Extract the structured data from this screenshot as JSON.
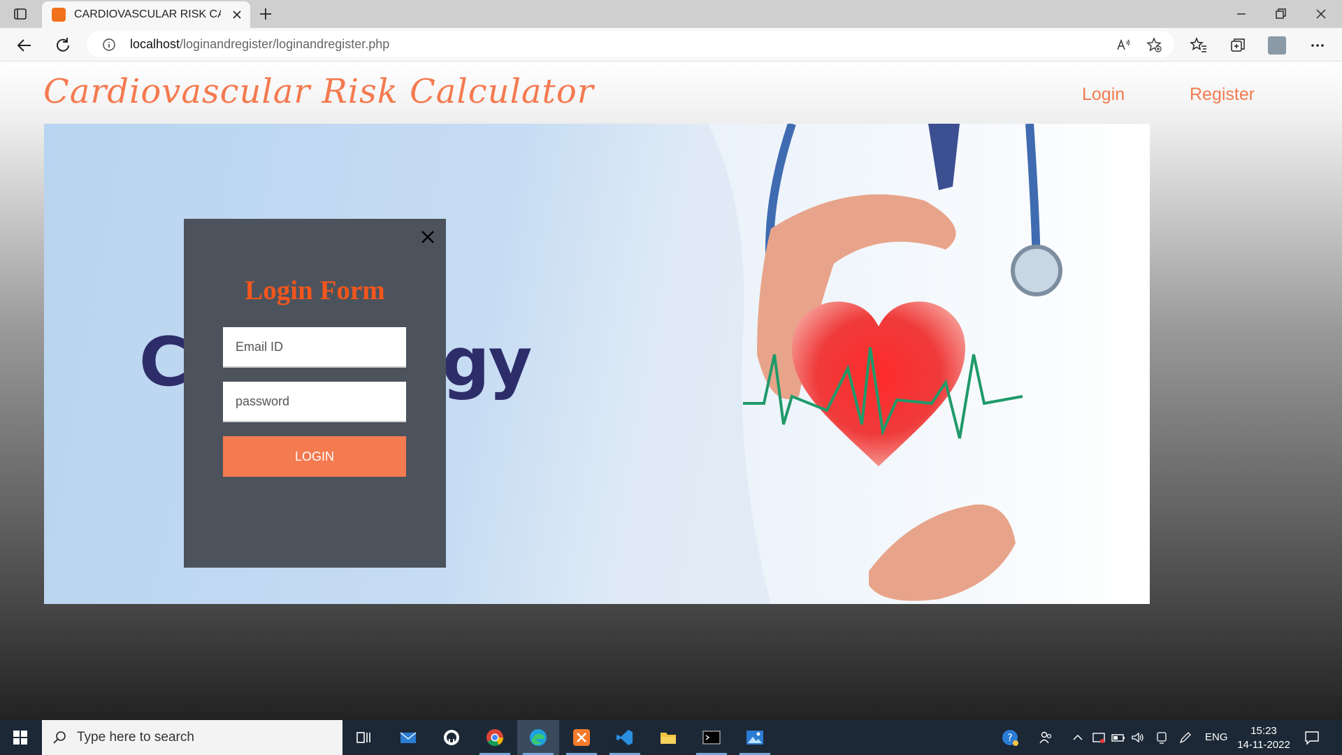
{
  "browser": {
    "tab_title": "CARDIOVASCULAR RISK CALCUL",
    "url_host": "localhost",
    "url_path": "/loginandregister/loginandregister.php"
  },
  "site": {
    "title": "Cardiovascular Risk Calculator",
    "nav": {
      "login": "Login",
      "register": "Register"
    }
  },
  "hero": {
    "word": "Cardiology"
  },
  "login_form": {
    "title": "Login Form",
    "email_placeholder": "Email ID",
    "password_placeholder": "password",
    "submit_label": "LOGIN"
  },
  "taskbar": {
    "search_placeholder": "Type here to search",
    "language": "ENG",
    "time": "15:23",
    "date": "14-11-2022"
  },
  "colors": {
    "accent": "#f47a4f",
    "form_title": "#f2561d",
    "modal_bg": "#4c535c",
    "taskbar_bg": "#1c2836"
  }
}
